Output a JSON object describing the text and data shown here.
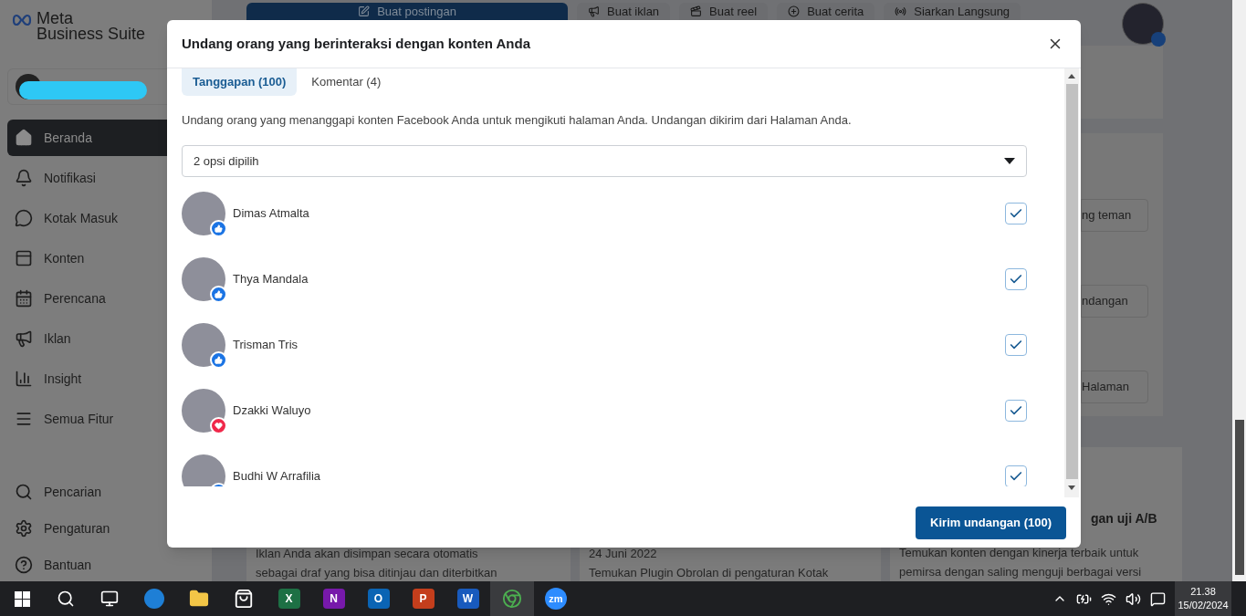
{
  "brand": {
    "line1": "Meta",
    "line2": "Business Suite"
  },
  "sidebar": {
    "nav_items": [
      {
        "label": "Beranda",
        "selected": true
      },
      {
        "label": "Notifikasi",
        "selected": false
      },
      {
        "label": "Kotak Masuk",
        "selected": false
      },
      {
        "label": "Konten",
        "selected": false
      },
      {
        "label": "Perencana",
        "selected": false
      },
      {
        "label": "Iklan",
        "selected": false
      },
      {
        "label": "Insight",
        "selected": false
      },
      {
        "label": "Semua Fitur",
        "selected": false
      }
    ],
    "bottom_items": [
      {
        "label": "Pencarian"
      },
      {
        "label": "Pengaturan"
      },
      {
        "label": "Bantuan"
      }
    ]
  },
  "top_actions": [
    {
      "label": "Buat postingan",
      "kind": "primary"
    },
    {
      "label": "Buat iklan",
      "kind": "plain"
    },
    {
      "label": "Buat reel",
      "kind": "plain"
    },
    {
      "label": "Buat cerita",
      "kind": "plain"
    },
    {
      "label": "Siarkan Langsung",
      "kind": "plain"
    }
  ],
  "side_buttons": [
    "ng teman",
    "ndangan",
    "Halaman"
  ],
  "cards": [
    {
      "lines": [
        "Iklan Anda akan disimpan secara otomatis",
        "sebagai draf yang bisa ditinjau dan diterbitkan"
      ]
    },
    {
      "lines": [
        "24 Juni 2022",
        "Temukan Plugin Obrolan di pengaturan Kotak"
      ]
    },
    {
      "title": "gan uji A/B",
      "lines": [
        "Temukan konten dengan kinerja terbaik untuk",
        "pemirsa dengan saling menguji berbagai versi"
      ]
    }
  ],
  "modal": {
    "title": "Undang orang yang berinteraksi dengan konten Anda",
    "tabs": [
      {
        "label": "Tanggapan (100)",
        "selected": true
      },
      {
        "label": "Komentar (4)",
        "selected": false
      }
    ],
    "description": "Undang orang yang menanggapi konten Facebook Anda untuk mengikuti halaman Anda. Undangan dikirim dari Halaman Anda.",
    "dropdown": {
      "value": "2 opsi dipilih"
    },
    "people": [
      {
        "name": "Dimas Atmalta",
        "kind": "like",
        "checked": true
      },
      {
        "name": "Thya Mandala",
        "kind": "like",
        "checked": true
      },
      {
        "name": "Trisman Tris",
        "kind": "like",
        "checked": true
      },
      {
        "name": "Dzakki Waluyo",
        "kind": "love",
        "checked": true
      },
      {
        "name": "Budhi W Arrafilia",
        "kind": "like",
        "checked": true
      }
    ],
    "submit": "Kirim undangan (100)"
  },
  "taskbar": {
    "apps": [
      {
        "letter": "X",
        "color": "#1d7044"
      },
      {
        "letter": "N",
        "color": "#7719aa"
      },
      {
        "letter": "O",
        "color": "#0a64b4"
      },
      {
        "letter": "P",
        "color": "#c43e1c"
      },
      {
        "letter": "W",
        "color": "#185abd"
      }
    ],
    "zoom": "zm",
    "time": "21.38",
    "date": "15/02/2024"
  }
}
